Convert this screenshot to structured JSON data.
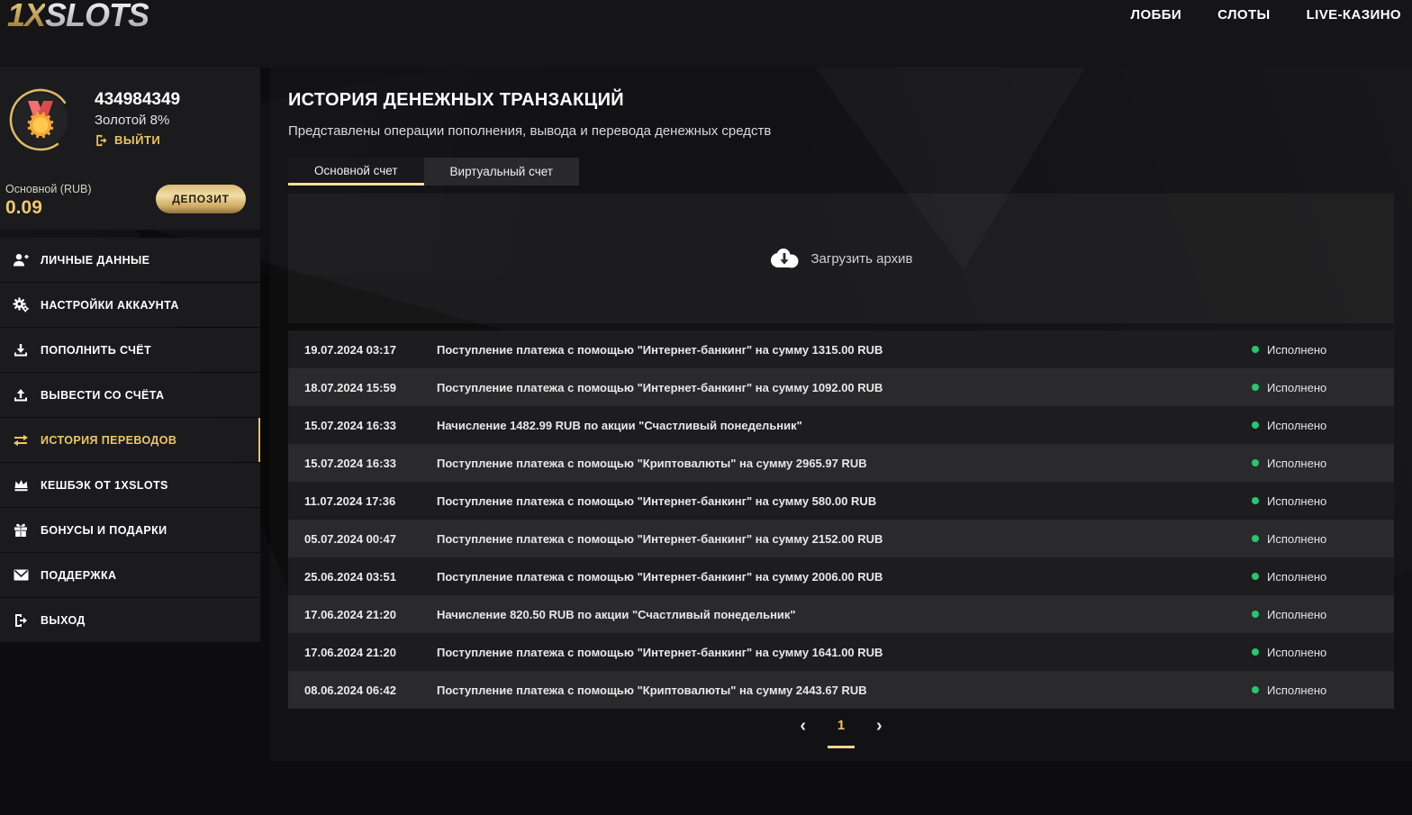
{
  "header": {
    "logo_part1": "1X",
    "logo_part2": "SLOTS",
    "nav_items": [
      {
        "label": "ЛОББИ"
      },
      {
        "label": "СЛОТЫ"
      },
      {
        "label": "LIVE-КАЗИНО"
      }
    ]
  },
  "profile": {
    "user_id": "434984349",
    "level": "Золотой 8%",
    "logout_label": "ВЫЙТИ",
    "balance_label": "Основной (RUB)",
    "balance_value": "0.09",
    "deposit_label": "ДЕПОЗИТ",
    "avatar_icon": "medal-icon"
  },
  "sidebar": {
    "items": [
      {
        "label": "ЛИЧНЫЕ ДАННЫЕ",
        "icon": "person-add-icon",
        "active": false
      },
      {
        "label": "НАСТРОЙКИ АККАУНТА",
        "icon": "gears-icon",
        "active": false
      },
      {
        "label": "ПОПОЛНИТЬ СЧЁТ",
        "icon": "deposit-download-icon",
        "active": false
      },
      {
        "label": "ВЫВЕСТИ СО СЧЁТА",
        "icon": "withdraw-upload-icon",
        "active": false
      },
      {
        "label": "ИСТОРИЯ ПЕРЕВОДОВ",
        "icon": "transfer-arrows-icon",
        "active": true
      },
      {
        "label": "КЕШБЭК ОТ 1XSLOTS",
        "icon": "crown-icon",
        "active": false
      },
      {
        "label": "БОНУСЫ И ПОДАРКИ",
        "icon": "gift-icon",
        "active": false
      },
      {
        "label": "ПОДДЕРЖКА",
        "icon": "envelope-icon",
        "active": false
      },
      {
        "label": "ВЫХОД",
        "icon": "logout-icon",
        "active": false
      }
    ]
  },
  "main": {
    "title": "ИСТОРИЯ ДЕНЕЖНЫХ ТРАНЗАКЦИЙ",
    "subtitle": "Представлены операции пополнения, вывода и перевода денежных средств",
    "tabs": [
      {
        "label": "Основной счет",
        "active": true
      },
      {
        "label": "Виртуальный счет",
        "active": false
      }
    ],
    "archive_button": {
      "label": "Загрузить архив",
      "icon": "cloud-download-icon"
    },
    "transactions": [
      {
        "date": "19.07.2024 03:17",
        "description": "Поступление платежа с помощью \"Интернет-банкинг\" на сумму 1315.00 RUB",
        "status": "Исполнено"
      },
      {
        "date": "18.07.2024 15:59",
        "description": "Поступление платежа с помощью \"Интернет-банкинг\" на сумму 1092.00 RUB",
        "status": "Исполнено"
      },
      {
        "date": "15.07.2024 16:33",
        "description": "Начисление 1482.99 RUB по акции \"Счастливый понедельник\"",
        "status": "Исполнено"
      },
      {
        "date": "15.07.2024 16:33",
        "description": "Поступление платежа с помощью \"Криптовалюты\" на сумму 2965.97 RUB",
        "status": "Исполнено"
      },
      {
        "date": "11.07.2024 17:36",
        "description": "Поступление платежа с помощью \"Интернет-банкинг\" на сумму 580.00 RUB",
        "status": "Исполнено"
      },
      {
        "date": "05.07.2024 00:47",
        "description": "Поступление платежа с помощью \"Интернет-банкинг\" на сумму 2152.00 RUB",
        "status": "Исполнено"
      },
      {
        "date": "25.06.2024 03:51",
        "description": "Поступление платежа с помощью \"Интернет-банкинг\" на сумму 2006.00 RUB",
        "status": "Исполнено"
      },
      {
        "date": "17.06.2024 21:20",
        "description": "Начисление 820.50 RUB по акции \"Счастливый понедельник\"",
        "status": "Исполнено"
      },
      {
        "date": "17.06.2024 21:20",
        "description": "Поступление платежа с помощью \"Интернет-банкинг\" на сумму 1641.00 RUB",
        "status": "Исполнено"
      },
      {
        "date": "08.06.2024 06:42",
        "description": "Поступление платежа с помощью \"Криптовалюты\" на сумму 2443.67 RUB",
        "status": "Исполнено"
      }
    ],
    "pagination": {
      "prev": "‹",
      "page": "1",
      "next": "›"
    }
  },
  "colors": {
    "gold_accent": "#e9c266",
    "tab_underline": "#f6dfa0",
    "status_green": "#2bc46f",
    "header_bg": "#151517",
    "panel_bg": "#1b1b1d"
  }
}
